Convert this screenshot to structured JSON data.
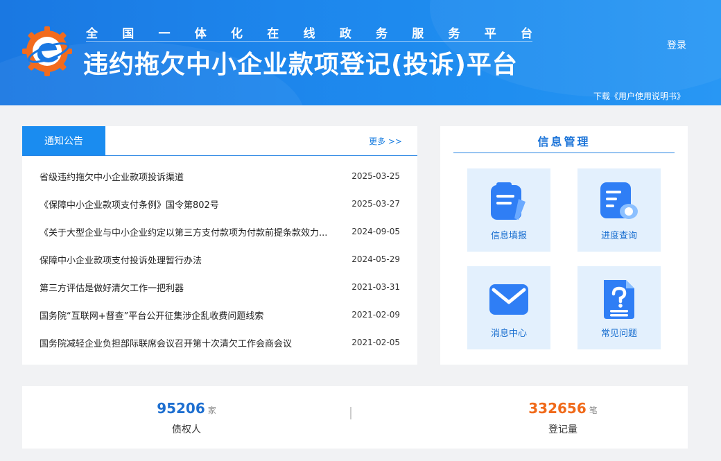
{
  "header": {
    "subtitle_chars": [
      "全",
      "国",
      "一",
      "体",
      "化",
      "在",
      "线",
      "政",
      "务",
      "服",
      "务",
      "平",
      "台"
    ],
    "title": "违约拖欠中小企业款项登记(投诉)平台",
    "login_label": "登录",
    "manual_link": "下载《用户使用说明书》"
  },
  "notices": {
    "tab_label": "通知公告",
    "more_label": "更多 >>",
    "items": [
      {
        "title": "省级违约拖欠中小企业款项投诉渠道",
        "date": "2025-03-25"
      },
      {
        "title": "《保障中小企业款项支付条例》国令第802号",
        "date": "2025-03-27"
      },
      {
        "title": "《关于大型企业与中小企业约定以第三方支付款项为付款前提条款效力...",
        "date": "2024-09-05"
      },
      {
        "title": "保障中小企业款项支付投诉处理暂行办法",
        "date": "2024-05-29"
      },
      {
        "title": "第三方评估是做好清欠工作一把利器",
        "date": "2021-03-31"
      },
      {
        "title": "国务院“互联网+督查”平台公开征集涉企乱收费问题线索",
        "date": "2021-02-09"
      },
      {
        "title": "国务院减轻企业负担部际联席会议召开第十次清欠工作会商会议",
        "date": "2021-02-05"
      }
    ]
  },
  "info": {
    "title": "信息管理",
    "tiles": [
      {
        "label": "信息填报",
        "icon": "edit-form-icon"
      },
      {
        "label": "进度查询",
        "icon": "progress-search-icon"
      },
      {
        "label": "消息中心",
        "icon": "mail-icon"
      },
      {
        "label": "常见问题",
        "icon": "faq-document-icon"
      }
    ]
  },
  "stats": {
    "creditors": {
      "value": "95206",
      "unit": "家",
      "label": "债权人",
      "color": "#1e6fd0"
    },
    "registrations": {
      "value": "332656",
      "unit": "笔",
      "label": "登记量",
      "color": "#f06a1a"
    }
  },
  "colors": {
    "brand_blue": "#1a8cf0",
    "tile_bg": "#e3f0fd",
    "logo_orange": "#f26b1d"
  }
}
